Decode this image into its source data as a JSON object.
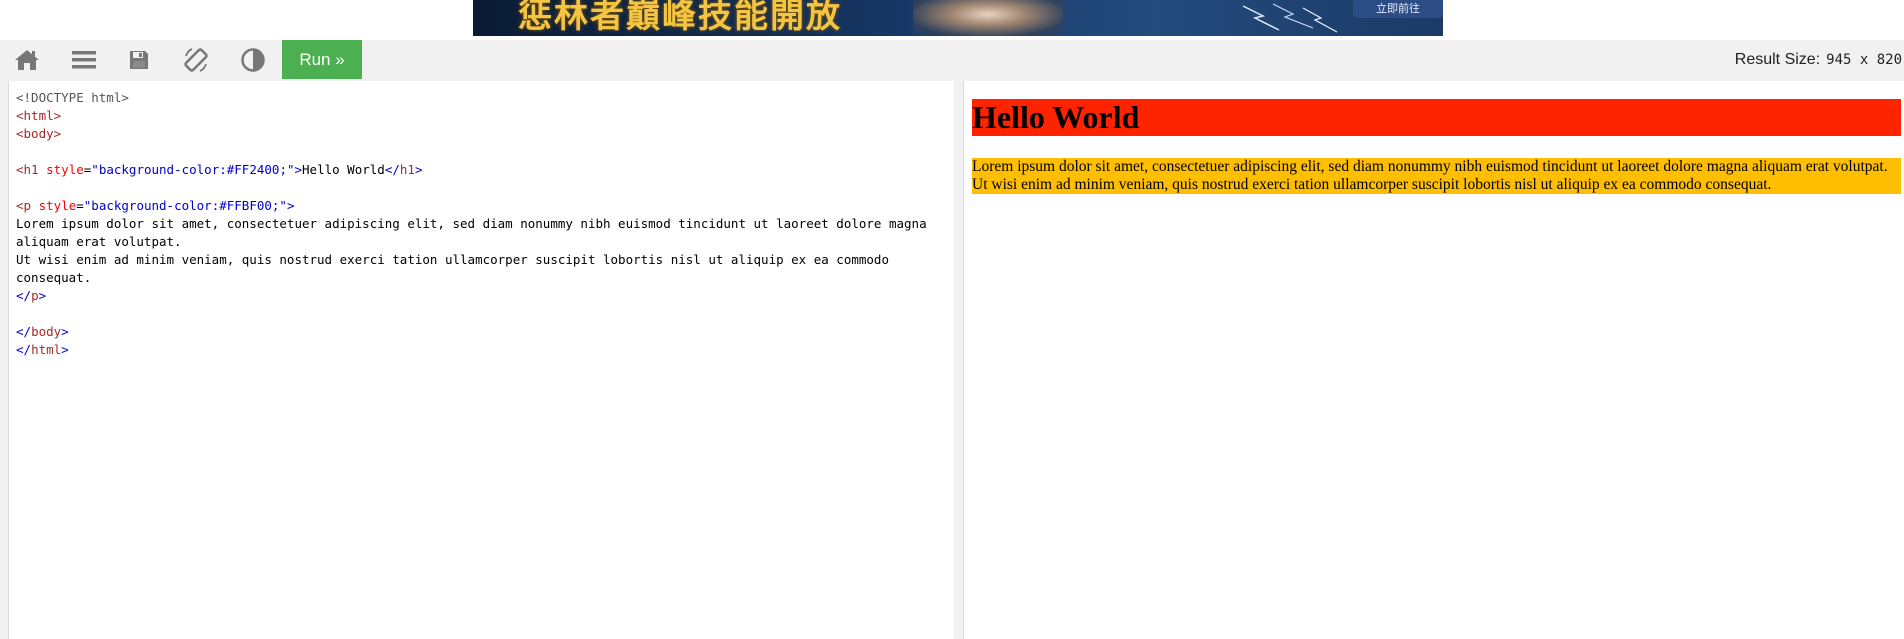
{
  "ad": {
    "headline": "惩林者巔峰技能開放",
    "cta_label": "立即前往"
  },
  "toolbar": {
    "home_icon": "home-icon",
    "menu_icon": "menu-icon",
    "save_icon": "save-icon",
    "rotate_icon": "rotate-icon",
    "theme_icon": "contrast-icon",
    "run_label": "Run »",
    "result_size_label": "Result Size:",
    "result_size_value": "945 x 820"
  },
  "editor": {
    "lines": {
      "doctype": "<!DOCTYPE html>",
      "html_open_lt": "<",
      "html_open_name": "html",
      "html_open_gt": ">",
      "body_open_name": "body",
      "h1_name": "h1",
      "style_attr": "style",
      "eq": "=",
      "h1_style_value": "\"background-color:#FF2400;\"",
      "h1_text": "Hello World",
      "h1_close_open": "</",
      "p_name": "p",
      "p_style_value": "\"background-color:#FFBF00;\"",
      "p_text_1": "Lorem ipsum dolor sit amet, consectetuer adipiscing elit, sed diam nonummy nibh euismod tincidunt ut laoreet dolore magna aliquam erat volutpat.",
      "p_text_2": "Ut wisi enim ad minim veniam, quis nostrud exerci tation ullamcorper suscipit lobortis nisl ut aliquip ex ea commodo consequat."
    }
  },
  "result": {
    "h1_text": "Hello World",
    "h1_bg": "#FF2400",
    "p_text": "Lorem ipsum dolor sit amet, consectetuer adipiscing elit, sed diam nonummy nibh euismod tincidunt ut laoreet dolore magna aliquam erat volutpat. Ut wisi enim ad minim veniam, quis nostrud exerci tation ullamcorper suscipit lobortis nisl ut aliquip ex ea commodo consequat.",
    "p_bg": "#FFBF00"
  },
  "colors": {
    "run_button": "#4CAF50",
    "toolbar_bg": "#F1F1F1",
    "icon_gray": "#777777"
  }
}
